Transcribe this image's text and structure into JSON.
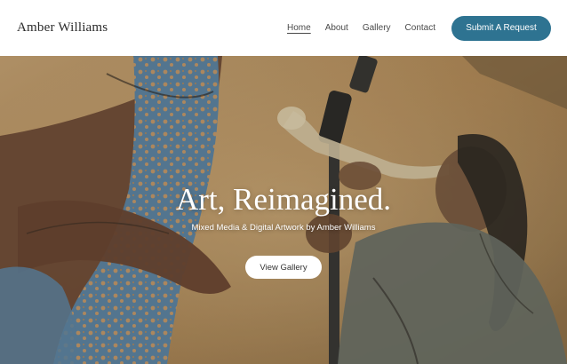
{
  "header": {
    "site_title": "Amber Williams",
    "nav": [
      {
        "label": "Home",
        "active": true
      },
      {
        "label": "About",
        "active": false
      },
      {
        "label": "Gallery",
        "active": false
      },
      {
        "label": "Contact",
        "active": false
      }
    ],
    "cta_label": "Submit A Request"
  },
  "hero": {
    "title": "Art, Reimagined.",
    "subtitle": "Mixed Media & Digital Artwork by Amber Williams",
    "button_label": "View Gallery"
  },
  "colors": {
    "accent": "#2e7391",
    "header_bg": "#ffffff",
    "hero_text": "#ffffff"
  }
}
